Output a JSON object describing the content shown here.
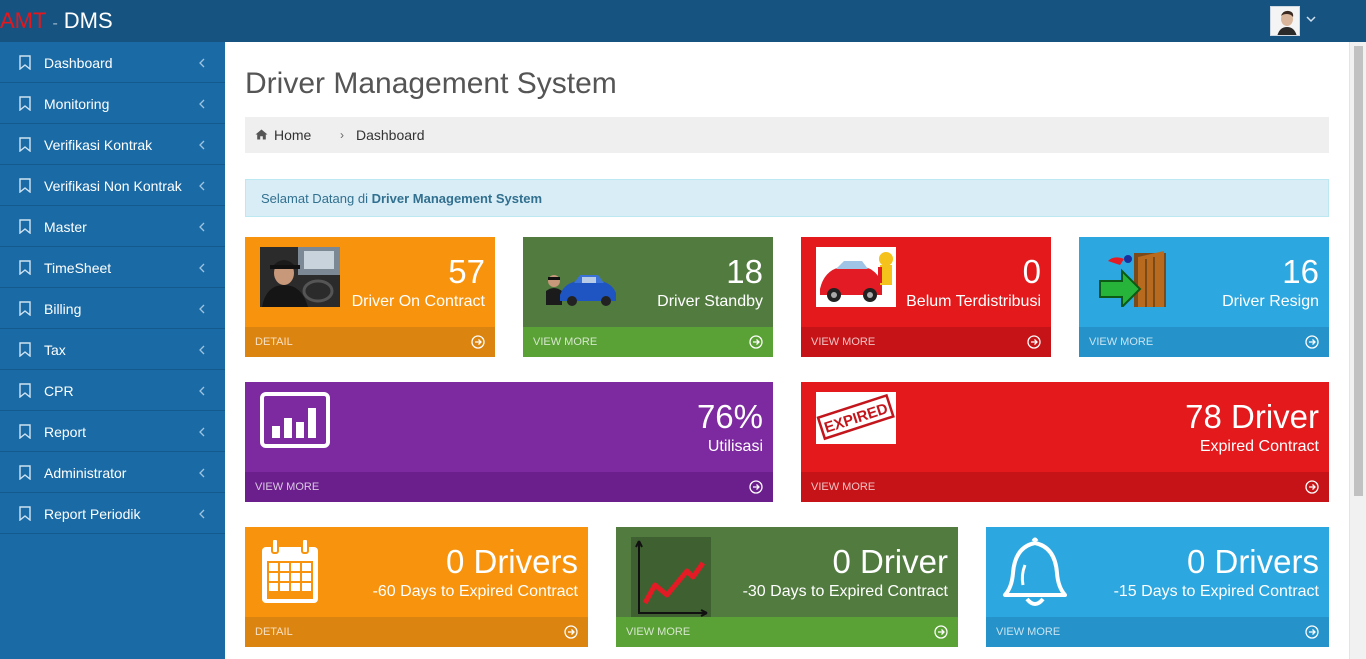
{
  "app": {
    "brand_prefix": "AMT",
    "brand_sep": "-",
    "brand_name": "DMS"
  },
  "header": {
    "user_menu_icon": "chevron-down-icon"
  },
  "sidebar": {
    "items": [
      {
        "label": "Dashboard"
      },
      {
        "label": "Monitoring"
      },
      {
        "label": "Verifikasi Kontrak"
      },
      {
        "label": "Verifikasi Non Kontrak"
      },
      {
        "label": "Master"
      },
      {
        "label": "TimeSheet"
      },
      {
        "label": "Billing"
      },
      {
        "label": "Tax"
      },
      {
        "label": "CPR"
      },
      {
        "label": "Report"
      },
      {
        "label": "Administrator"
      },
      {
        "label": "Report Periodik"
      }
    ]
  },
  "main": {
    "title": "Driver Management System",
    "breadcrumb": {
      "home": "Home",
      "arrow": "›",
      "current": "Dashboard"
    },
    "alert": {
      "prefix": "Selamat Datang di ",
      "strong": "Driver Management System"
    },
    "tiles": [
      {
        "value": "57",
        "label": "Driver On Contract",
        "link": "DETAIL",
        "color": "#f7930c"
      },
      {
        "value": "18",
        "label": "Driver Standby",
        "link": "VIEW MORE",
        "color": "#527b40"
      },
      {
        "value": "0",
        "label": "Belum Terdistribusi",
        "link": "VIEW MORE",
        "color": "#e3191b"
      },
      {
        "value": "16",
        "label": "Driver Resign",
        "link": "VIEW MORE",
        "color": "#2ca7df"
      },
      {
        "value": "76%",
        "label": "Utilisasi",
        "link": "VIEW MORE",
        "color": "#7d2aa0"
      },
      {
        "value": "78 Driver",
        "label": "Expired Contract",
        "link": "VIEW MORE",
        "color": "#e3191b",
        "stamp": "EXPIRED"
      },
      {
        "value": "0 Drivers",
        "label": "-60 Days to Expired Contract",
        "link": "DETAIL",
        "color": "#f7930c"
      },
      {
        "value": "0 Driver",
        "label": "-30 Days to Expired Contract",
        "link": "VIEW MORE",
        "color": "#527b40"
      },
      {
        "value": "0 Drivers",
        "label": "-15 Days to Expired Contract",
        "link": "VIEW MORE",
        "color": "#2ca7df"
      }
    ]
  }
}
